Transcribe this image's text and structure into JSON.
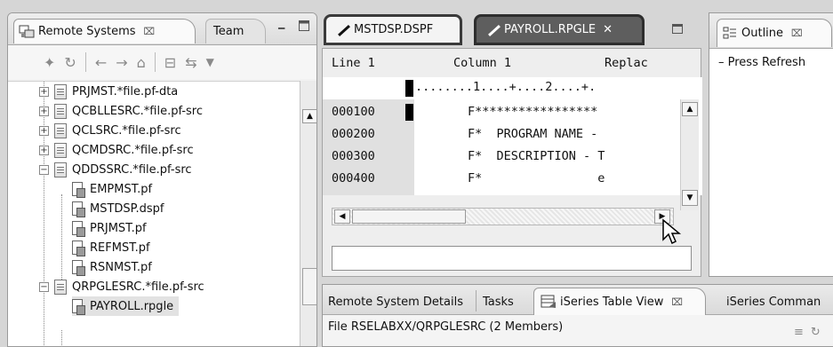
{
  "left_panel": {
    "tabs": [
      {
        "label": "Remote Systems",
        "close": "⌧"
      },
      {
        "label": "Team"
      }
    ],
    "tree": [
      {
        "label": "PRJMST.*file.pf-dta",
        "kind": "file",
        "expander": "+"
      },
      {
        "label": "QCBLLESRC.*file.pf-src",
        "kind": "file",
        "expander": "+"
      },
      {
        "label": "QCLSRC.*file.pf-src",
        "kind": "file",
        "expander": "+"
      },
      {
        "label": "QCMDSRC.*file.pf-src",
        "kind": "file",
        "expander": "+"
      },
      {
        "label": "QDDSSRC.*file.pf-src",
        "kind": "file",
        "expander": "−"
      },
      {
        "label": "EMPMST.pf",
        "kind": "member"
      },
      {
        "label": "MSTDSP.dspf",
        "kind": "member"
      },
      {
        "label": "PRJMST.pf",
        "kind": "member"
      },
      {
        "label": "REFMST.pf",
        "kind": "member"
      },
      {
        "label": "RSNMST.pf",
        "kind": "member"
      },
      {
        "label": "QRPGLESRC.*file.pf-src",
        "kind": "file",
        "expander": "−"
      },
      {
        "label": "PAYROLL.rpgle",
        "kind": "member",
        "selected": true
      }
    ]
  },
  "editor": {
    "tabs": [
      {
        "label": "MSTDSP.DSPF"
      },
      {
        "label": "PAYROLL.RPGLE",
        "close": "✕",
        "active": true
      }
    ],
    "status": {
      "line": "Line 1",
      "column": "Column 1",
      "mode": "Replac"
    },
    "ruler": "........1....+....2....+.",
    "lines": [
      {
        "seq": "000100",
        "src": "F*****************"
      },
      {
        "seq": "000200",
        "src": "F*  PROGRAM NAME -"
      },
      {
        "seq": "000300",
        "src": "F*  DESCRIPTION - T"
      },
      {
        "seq": "000400",
        "src": "F*                e"
      }
    ]
  },
  "outline": {
    "tab_label": "Outline",
    "close": "⌧",
    "message": "– Press Refresh"
  },
  "bottom_panel": {
    "tabs": [
      {
        "label": "Remote System Details"
      },
      {
        "label": "Tasks"
      },
      {
        "label": "iSeries Table View",
        "close": "⌧",
        "active": true
      },
      {
        "label": "iSeries Comman"
      }
    ],
    "info": "File RSELABXX/QRPGLESRC (2 Members)"
  },
  "colors": {
    "active_tab_bg": "#5e5e5e",
    "panel_bg": "#f2f2f2",
    "seq_col_bg": "#e0e0e0"
  }
}
